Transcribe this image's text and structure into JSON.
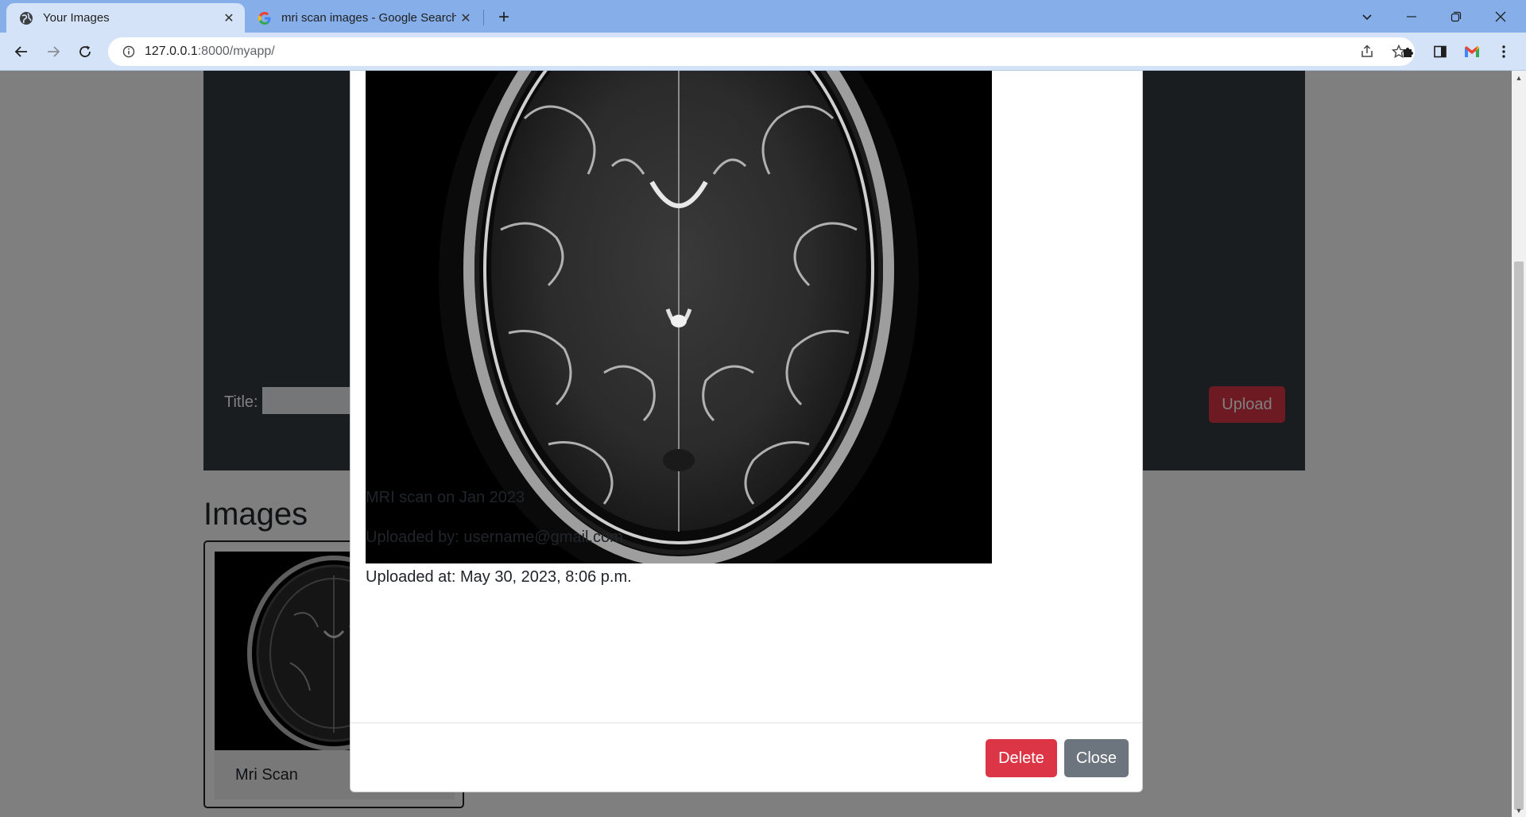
{
  "browser": {
    "tabs": [
      {
        "title": "Your Images",
        "active": true,
        "icon": "globe-icon"
      },
      {
        "title": "mri scan images - Google Search",
        "active": false,
        "icon": "google-icon"
      }
    ],
    "url": {
      "host": "127.0.0.1",
      "rest": ":8000/myapp/"
    }
  },
  "form": {
    "title_label": "Title:",
    "title_value": "",
    "upload_label": "Upload"
  },
  "gallery": {
    "heading": "Images",
    "cards": [
      {
        "title": "Mri Scan"
      }
    ]
  },
  "modal": {
    "description": "MRI scan on Jan 2023",
    "uploaded_by": "Uploaded by: username@gmail.com",
    "uploaded_at": "Uploaded at: May 30, 2023, 8:06 p.m.",
    "delete_label": "Delete",
    "close_label": "Close"
  },
  "colors": {
    "danger": "#dc3545",
    "secondary": "#6c757d",
    "dark_panel": "#343a40",
    "tabstrip": "#86aee9",
    "toolbar": "#d5e3f8"
  }
}
